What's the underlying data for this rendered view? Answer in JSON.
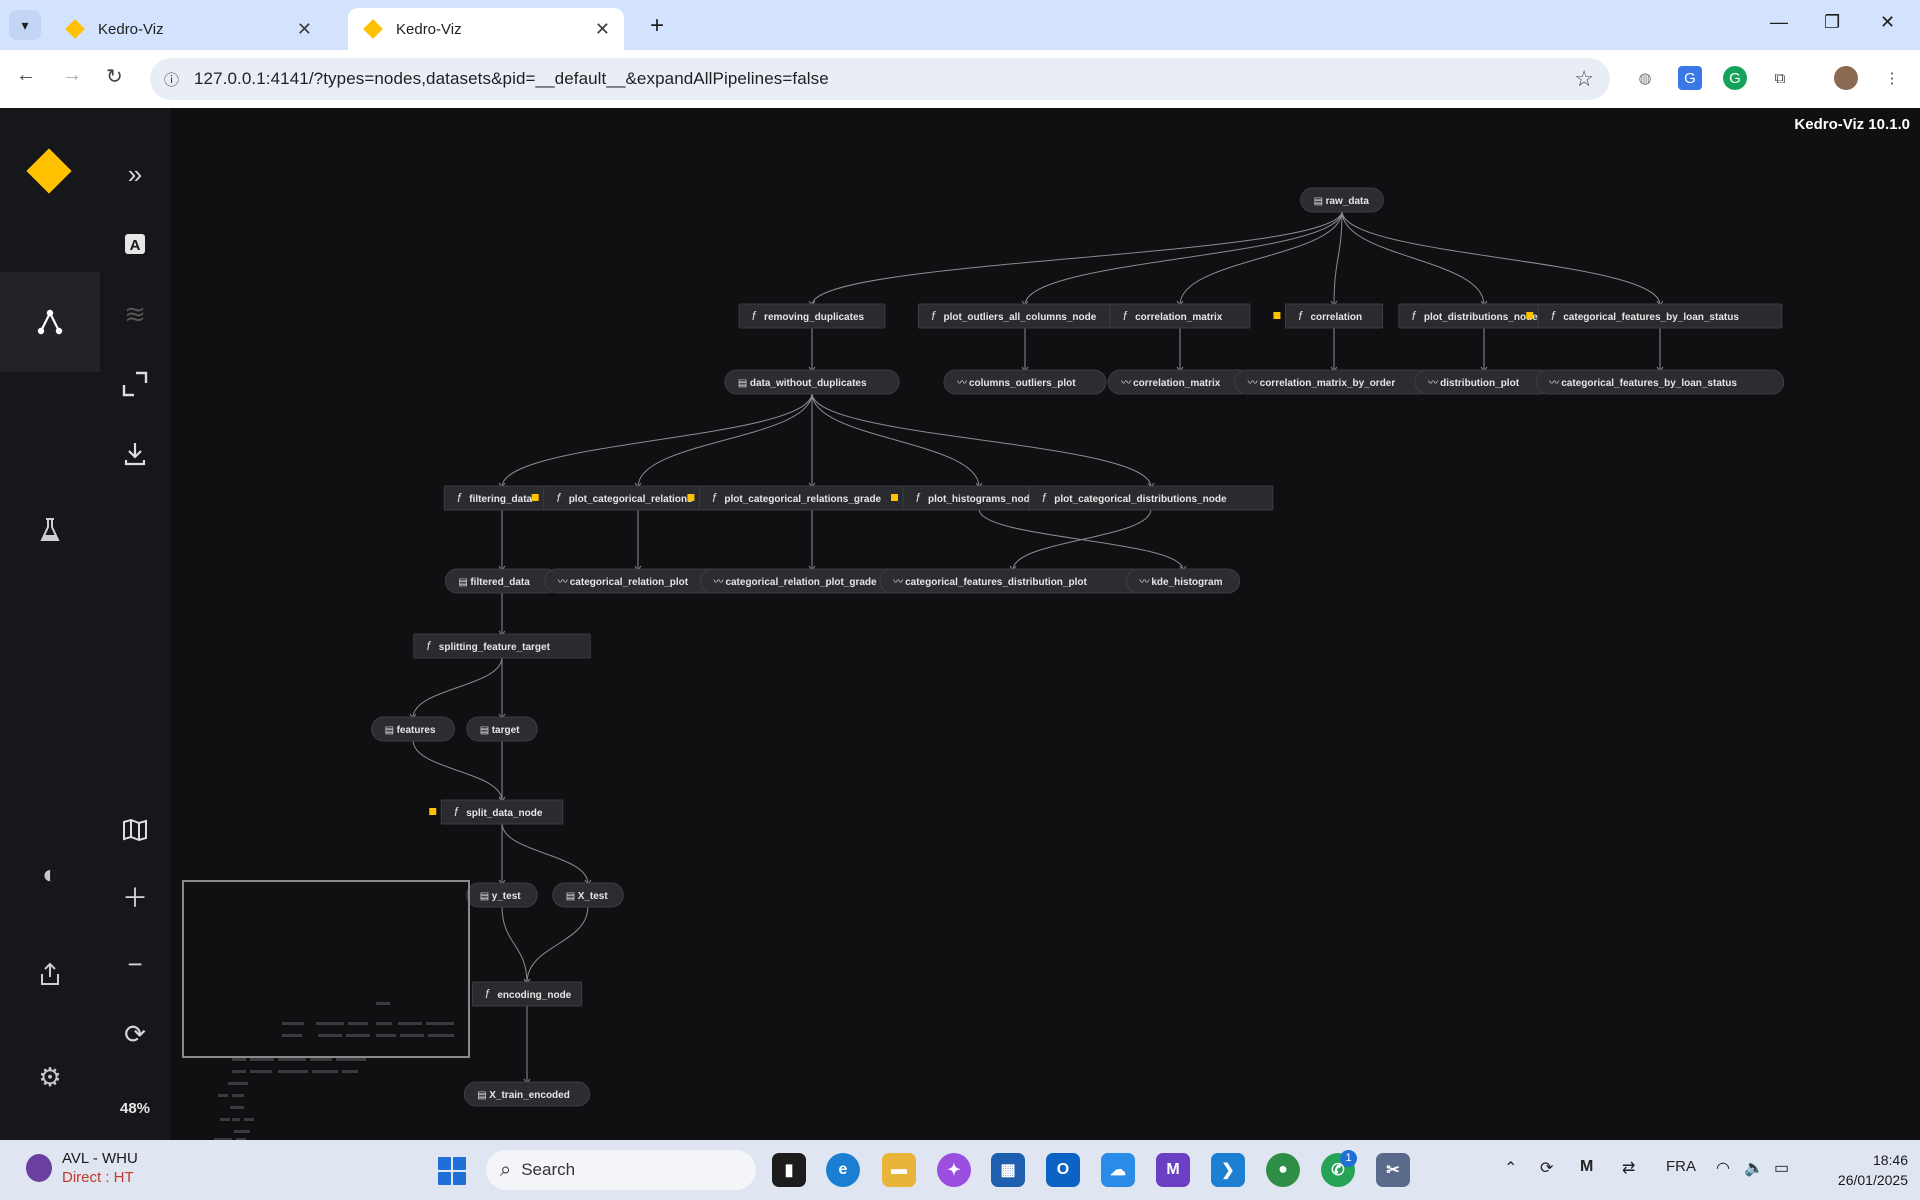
{
  "browser": {
    "tabs": [
      {
        "title": "Kedro-Viz",
        "active": false
      },
      {
        "title": "Kedro-Viz",
        "active": true
      }
    ],
    "new_tab_symbol": "+",
    "url": "127.0.0.1:4141/?types=nodes,datasets&pid=__default__&expandAllPipelines=false",
    "window_controls": [
      "minimize-icon",
      "restore-icon",
      "close-icon"
    ]
  },
  "app": {
    "version": "Kedro-Viz 10.1.0",
    "zoom": "48%",
    "brand_color": "#ffc100",
    "sidebar_icons": [
      "flowchart-icon",
      "experiment-flask-icon",
      "theme-contrast-icon",
      "export-icon",
      "settings-gear-icon"
    ],
    "toolbar_icons": [
      "expand-sidebar-icon",
      "text-labels-icon",
      "layers-icon",
      "fit-to-screen-icon",
      "download-icon",
      "minimap-icon",
      "zoom-in-icon",
      "zoom-out-icon",
      "reset-view-icon"
    ]
  },
  "graph": {
    "nodes": [
      {
        "id": "raw_data",
        "label": "raw_data",
        "kind": "dataset"
      },
      {
        "id": "removing_duplicates",
        "label": "removing_duplicates",
        "kind": "task"
      },
      {
        "id": "plot_outliers_all_columns_node",
        "label": "plot_outliers_all_columns_node",
        "kind": "task"
      },
      {
        "id": "correlation_matrix_fn",
        "label": "correlation_matrix",
        "kind": "task"
      },
      {
        "id": "correlation",
        "label": "correlation",
        "kind": "task",
        "flag": true
      },
      {
        "id": "plot_distributions_node",
        "label": "plot_distributions_node",
        "kind": "task"
      },
      {
        "id": "categorical_features_by_loan_status_fn",
        "label": "categorical_features_by_loan_status",
        "kind": "task",
        "flag": true
      },
      {
        "id": "data_without_duplicates",
        "label": "data_without_duplicates",
        "kind": "dataset"
      },
      {
        "id": "columns_outliers_plot",
        "label": "columns_outliers_plot",
        "kind": "plot"
      },
      {
        "id": "correlation_matrix_plot",
        "label": "correlation_matrix",
        "kind": "plot"
      },
      {
        "id": "correlation_matrix_by_order",
        "label": "correlation_matrix_by_order",
        "kind": "plot"
      },
      {
        "id": "distribution_plot",
        "label": "distribution_plot",
        "kind": "plot"
      },
      {
        "id": "categorical_features_by_loan_status_plot",
        "label": "categorical_features_by_loan_status",
        "kind": "plot"
      },
      {
        "id": "filtering_data",
        "label": "filtering_data",
        "kind": "task"
      },
      {
        "id": "plot_categorical_relations",
        "label": "plot_categorical_relations",
        "kind": "task",
        "flag": true
      },
      {
        "id": "plot_categorical_relations_grade",
        "label": "plot_categorical_relations_grade",
        "kind": "task",
        "flag": true
      },
      {
        "id": "plot_histograms_node",
        "label": "plot_histograms_node",
        "kind": "task",
        "flag": true
      },
      {
        "id": "plot_categorical_distributions_node",
        "label": "plot_categorical_distributions_node",
        "kind": "task"
      },
      {
        "id": "filtered_data",
        "label": "filtered_data",
        "kind": "dataset"
      },
      {
        "id": "categorical_relation_plot",
        "label": "categorical_relation_plot",
        "kind": "plot"
      },
      {
        "id": "categorical_relation_plot_grade",
        "label": "categorical_relation_plot_grade",
        "kind": "plot"
      },
      {
        "id": "categorical_features_distribution_plot",
        "label": "categorical_features_distribution_plot",
        "kind": "plot"
      },
      {
        "id": "kde_histogram",
        "label": "kde_histogram",
        "kind": "plot"
      },
      {
        "id": "splitting_feature_target",
        "label": "splitting_feature_target",
        "kind": "task"
      },
      {
        "id": "features",
        "label": "features",
        "kind": "dataset"
      },
      {
        "id": "target",
        "label": "target",
        "kind": "dataset"
      },
      {
        "id": "split_data_node",
        "label": "split_data_node",
        "kind": "task",
        "flag": true
      },
      {
        "id": "y_test",
        "label": "y_test",
        "kind": "dataset"
      },
      {
        "id": "X_test",
        "label": "X_test",
        "kind": "dataset"
      },
      {
        "id": "encoding_node",
        "label": "encoding_node",
        "kind": "task"
      },
      {
        "id": "X_train_encoded",
        "label": "X_train_encoded",
        "kind": "dataset"
      }
    ]
  },
  "taskbar": {
    "weather_line1": "AVL - WHU",
    "weather_line2": "Direct : HT",
    "search_placeholder": "Search",
    "language": "FRA",
    "time": "18:46",
    "date": "26/01/2025",
    "notification_badge": "1"
  }
}
